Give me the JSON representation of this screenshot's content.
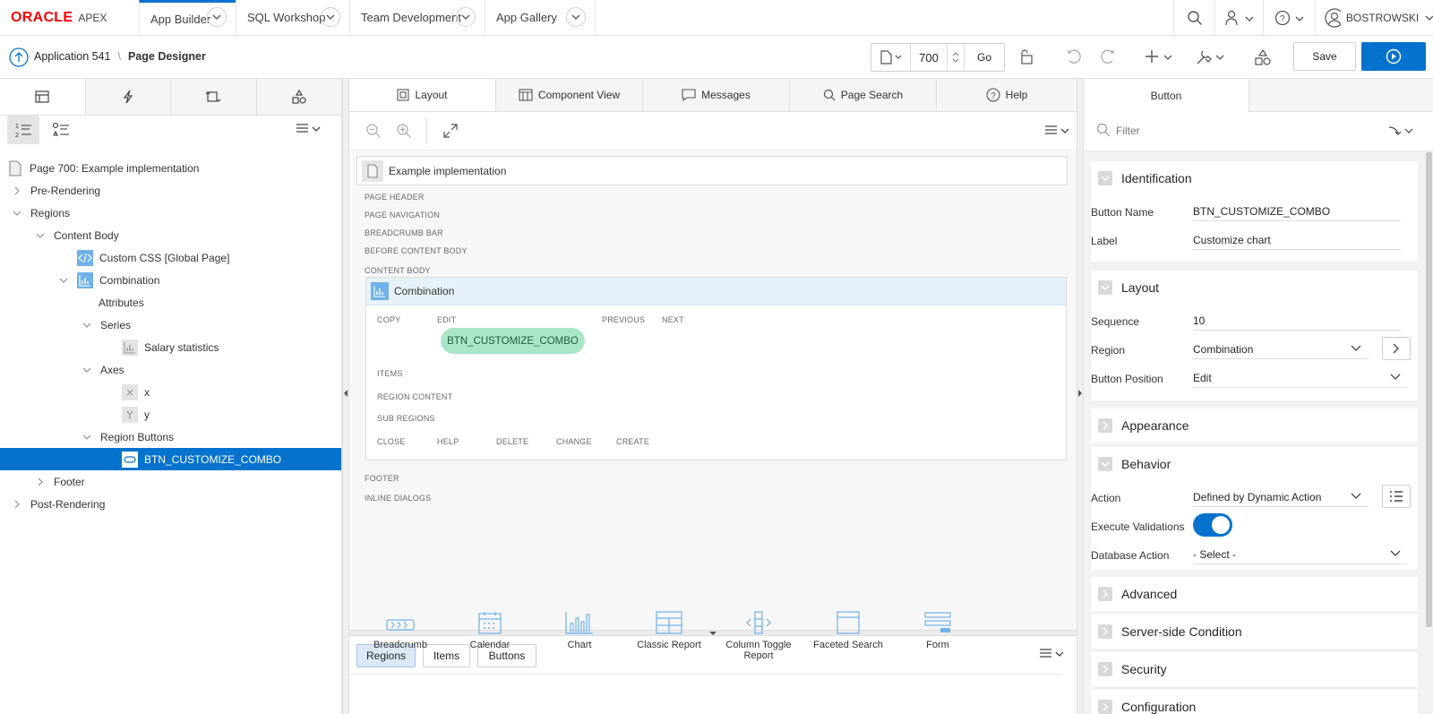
{
  "topbar": {
    "logo_oracle": "ORACLE",
    "logo_apex": "APEX",
    "tabs": [
      {
        "label": "App Builder"
      },
      {
        "label": "SQL Workshop"
      },
      {
        "label": "Team Development"
      },
      {
        "label": "App Gallery"
      }
    ],
    "user": "BOSTROWSKI"
  },
  "toolbar": {
    "breadcrumb_app": "Application 541",
    "breadcrumb_sep": "\\",
    "breadcrumb_page": "Page Designer",
    "page_number": "700",
    "go_label": "Go",
    "save_label": "Save"
  },
  "left": {
    "tree": [
      {
        "label": "Page 700: Example implementation"
      },
      {
        "label": "Pre-Rendering"
      },
      {
        "label": "Regions"
      },
      {
        "label": "Content Body"
      },
      {
        "label": "Custom CSS [Global Page]"
      },
      {
        "label": "Combination"
      },
      {
        "label": "Attributes"
      },
      {
        "label": "Series"
      },
      {
        "label": "Salary statistics"
      },
      {
        "label": "Axes"
      },
      {
        "label": "x"
      },
      {
        "label": "y"
      },
      {
        "label": "Region Buttons"
      },
      {
        "label": "BTN_CUSTOMIZE_COMBO"
      },
      {
        "label": "Footer"
      },
      {
        "label": "Post-Rendering"
      }
    ]
  },
  "middle": {
    "tabs": [
      {
        "label": "Layout"
      },
      {
        "label": "Component View"
      },
      {
        "label": "Messages"
      },
      {
        "label": "Page Search"
      },
      {
        "label": "Help"
      }
    ],
    "page_title": "Example implementation",
    "positions": {
      "page_header": "PAGE HEADER",
      "page_navigation": "PAGE NAVIGATION",
      "breadcrumb_bar": "BREADCRUMB BAR",
      "before_content_body": "BEFORE CONTENT BODY",
      "content_body": "CONTENT BODY",
      "footer": "FOOTER",
      "inline_dialogs": "INLINE DIALOGS"
    },
    "region": {
      "title": "Combination",
      "copy": "COPY",
      "edit": "EDIT",
      "previous": "PREVIOUS",
      "next": "NEXT",
      "button": "BTN_CUSTOMIZE_COMBO",
      "items": "ITEMS",
      "region_content": "REGION CONTENT",
      "sub_regions": "SUB REGIONS",
      "close": "CLOSE",
      "help": "HELP",
      "delete": "DELETE",
      "change": "CHANGE",
      "create": "CREATE"
    },
    "gallery_tabs": [
      {
        "label": "Regions"
      },
      {
        "label": "Items"
      },
      {
        "label": "Buttons"
      }
    ],
    "gallery": [
      {
        "label": "Breadcrumb",
        "icon": "breadcrumb-icon"
      },
      {
        "label": "Calendar",
        "icon": "calendar-icon"
      },
      {
        "label": "Chart",
        "icon": "chart-icon"
      },
      {
        "label": "Classic Report",
        "icon": "classic-report-icon"
      },
      {
        "label": "Column Toggle Report",
        "icon": "column-toggle-icon"
      },
      {
        "label": "Faceted Search",
        "icon": "faceted-search-icon"
      },
      {
        "label": "Form",
        "icon": "form-icon"
      }
    ]
  },
  "right": {
    "tab": "Button",
    "filter_placeholder": "Filter",
    "sections": {
      "identification": "Identification",
      "layout": "Layout",
      "appearance": "Appearance",
      "behavior": "Behavior",
      "advanced": "Advanced",
      "server_side_condition": "Server-side Condition",
      "security": "Security",
      "configuration": "Configuration"
    },
    "props": {
      "button_name_label": "Button Name",
      "button_name": "BTN_CUSTOMIZE_COMBO",
      "label_label": "Label",
      "label": "Customize chart",
      "sequence_label": "Sequence",
      "sequence": "10",
      "region_label": "Region",
      "region": "Combination",
      "button_position_label": "Button Position",
      "button_position": "Edit",
      "action_label": "Action",
      "action": "Defined by Dynamic Action",
      "execute_validations_label": "Execute Validations",
      "execute_validations": true,
      "database_action_label": "Database Action",
      "database_action": "- Select -"
    }
  },
  "colors": {
    "accent": "#0572ce",
    "oracle_red": "#f80000",
    "button_pill": "#a8e6c7",
    "region_header": "#e7f1fa"
  }
}
